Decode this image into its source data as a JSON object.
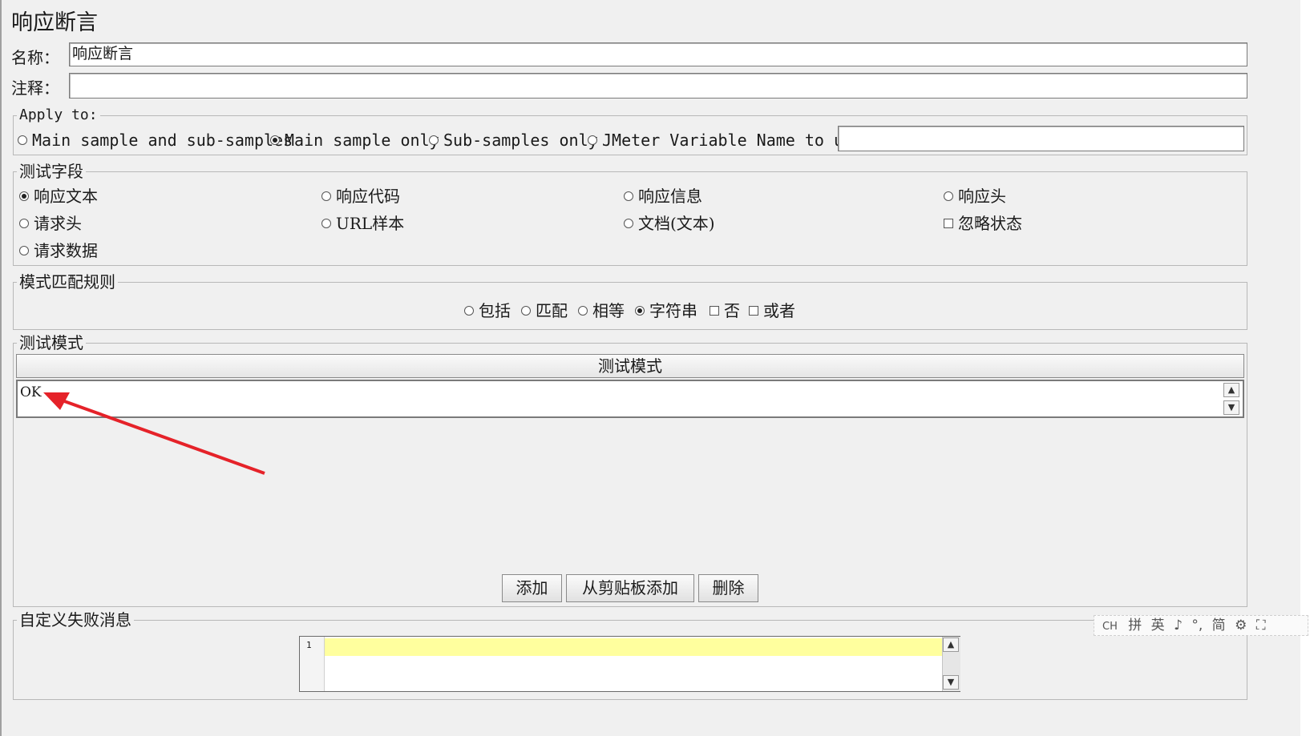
{
  "title": "响应断言",
  "name_label": "名称：",
  "name_value": "响应断言",
  "comment_label": "注释：",
  "comment_value": "",
  "apply_to": {
    "legend": "Apply to:",
    "options": [
      "Main sample and sub-samples",
      "Main sample only",
      "Sub-samples only",
      "JMeter Variable Name to use"
    ],
    "selected": "Main sample only",
    "variable_value": ""
  },
  "test_field": {
    "legend": "测试字段",
    "options": [
      "响应文本",
      "响应代码",
      "响应信息",
      "响应头",
      "请求头",
      "URL样本",
      "文档(文本)",
      "忽略状态",
      "请求数据"
    ],
    "selected": "响应文本"
  },
  "pattern_rules": {
    "legend": "模式匹配规则",
    "options": [
      "包括",
      "匹配",
      "相等",
      "字符串",
      "否",
      "或者"
    ],
    "selected": "字符串"
  },
  "test_patterns": {
    "legend": "测试模式",
    "column_header": "测试模式",
    "rows": [
      "OK"
    ]
  },
  "buttons": {
    "add": "添加",
    "add_clipboard": "从剪贴板添加",
    "delete": "删除"
  },
  "custom_failure": {
    "legend": "自定义失败消息",
    "line_number": "1"
  },
  "ime_toolbar": {
    "items": [
      "CH",
      "拼",
      "英",
      "♪",
      "°,",
      "简",
      "⚙",
      "⛶"
    ]
  }
}
